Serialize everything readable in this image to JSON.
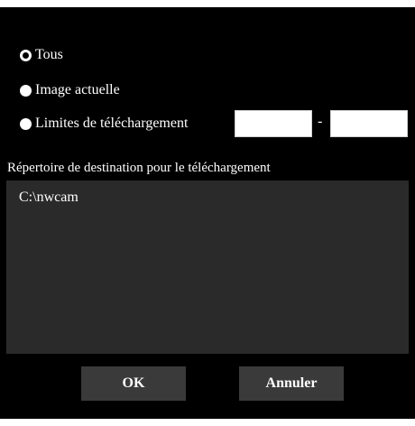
{
  "options": [
    {
      "label": "Tous",
      "selected": true
    },
    {
      "label": "Image actuelle",
      "selected": false
    },
    {
      "label": "Limites de téléchargement",
      "selected": false
    }
  ],
  "range": {
    "from_value": "",
    "to_value": "",
    "separator": "-"
  },
  "destination": {
    "label": "Répertoire de destination pour le téléchargement",
    "path": "C:\\nwcam"
  },
  "buttons": {
    "ok_label": "OK",
    "cancel_label": "Annuler"
  },
  "colors": {
    "dialog_background": "#000000",
    "panel_background": "#2a2a2a",
    "button_background": "#3a3a3a",
    "text": "#ffffff"
  }
}
